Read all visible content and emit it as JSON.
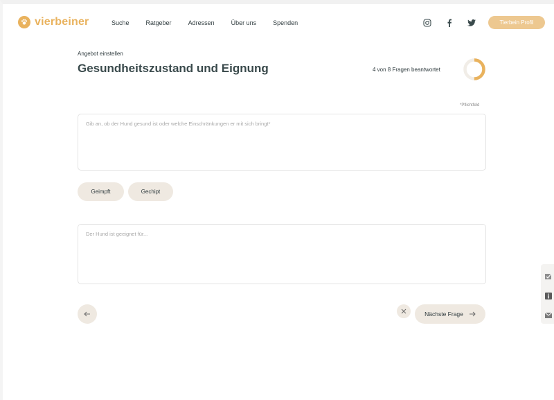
{
  "header": {
    "brand": "vierbeiner",
    "nav": [
      {
        "label": "Suche"
      },
      {
        "label": "Ratgeber"
      },
      {
        "label": "Adressen"
      },
      {
        "label": "Über uns"
      },
      {
        "label": "Spenden"
      }
    ],
    "social_icons": [
      "instagram-icon",
      "facebook-icon",
      "twitter-icon"
    ],
    "profile_button": "Tierbein Profil"
  },
  "form": {
    "eyebrow": "Angebot einstellen",
    "title": "Gesundheitszustand und Eignung",
    "progress_text": "4 von 8 Fragen beantwortet",
    "progress": {
      "answered": 4,
      "total": 8
    },
    "required_note": "*Pflichtfeld",
    "health_placeholder": "Gib an, ob der Hund gesund ist oder welche Einschränkungen er mit sich bringt*",
    "chips": [
      {
        "label": "Geimpft"
      },
      {
        "label": "Gechipt"
      }
    ],
    "suitability_placeholder": "Der Hund ist geeignet für...",
    "next_button": "Nächste Frage"
  },
  "colors": {
    "accent": "#e9b25d",
    "profile_button": "#edc890",
    "chip_bg": "#efe9e1",
    "heading": "#3a4a4c"
  }
}
